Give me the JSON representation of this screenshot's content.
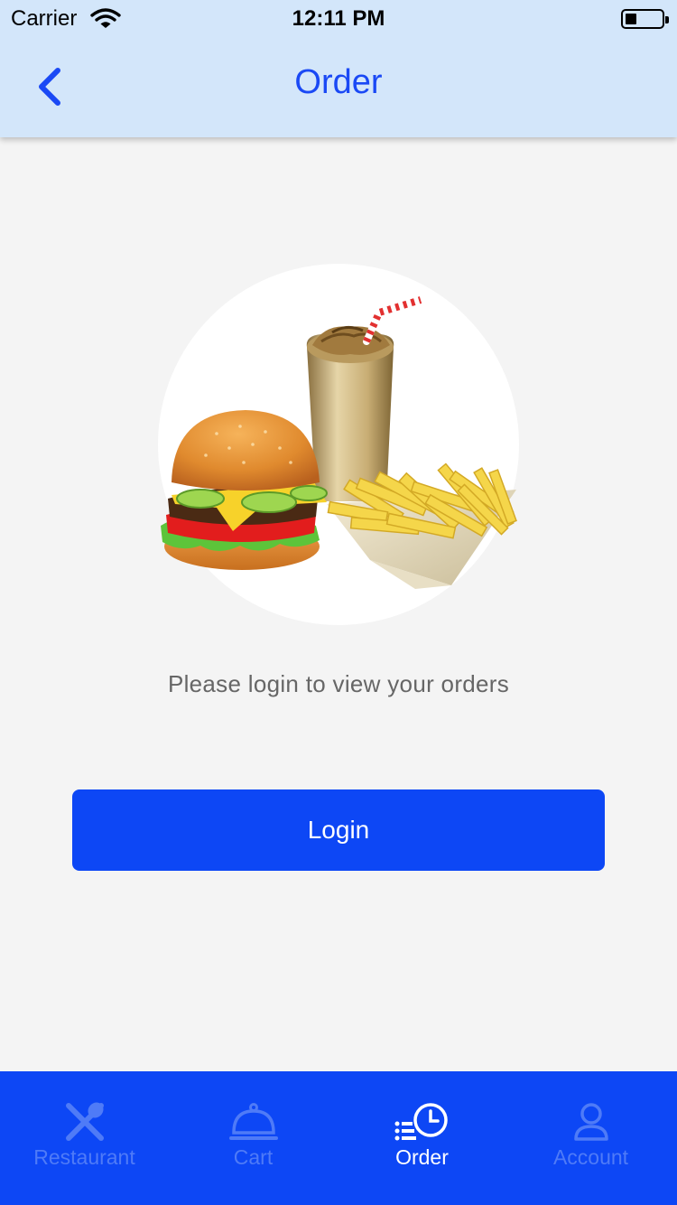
{
  "status_bar": {
    "carrier": "Carrier",
    "time": "12:11 PM",
    "battery_level": 0.3
  },
  "nav": {
    "back_icon": "chevron-left-icon",
    "title": "Order"
  },
  "content": {
    "illustration": "burger-fries-shake-illustration",
    "message": "Please login to view your orders",
    "login_label": "Login"
  },
  "tabs": [
    {
      "label": "Restaurant",
      "icon": "fork-spoon-icon",
      "active": false
    },
    {
      "label": "Cart",
      "icon": "service-bell-icon",
      "active": false
    },
    {
      "label": "Order",
      "icon": "order-clock-icon",
      "active": true
    },
    {
      "label": "Account",
      "icon": "user-icon",
      "active": false
    }
  ],
  "colors": {
    "accent": "#0d47f5",
    "nav_background": "#d3e6fa",
    "title_color": "#1a49f5",
    "page_background": "#f4f4f4",
    "inactive_tab": "#4f7bf7"
  }
}
